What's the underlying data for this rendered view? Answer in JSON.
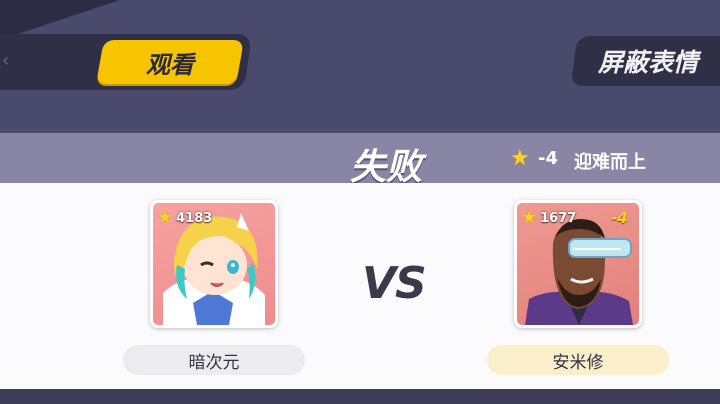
{
  "header": {
    "watch_label": "观看",
    "mute_emotes_label": "屏蔽表情"
  },
  "result": {
    "title": "失败",
    "star_change": "-4",
    "bonus_label": "迎难而上"
  },
  "vs_label": "VS",
  "players": [
    {
      "name": "暗次元",
      "score": "4183",
      "delta": ""
    },
    {
      "name": "安米修",
      "score": "1677",
      "delta": "-4"
    }
  ],
  "colors": {
    "background": "#4a4a6c",
    "accent_yellow": "#f7c400",
    "result_band": "#8886a4",
    "left_name_pill": "#ececf0",
    "right_name_pill": "#fbeeca"
  },
  "icons": [
    "star-icon",
    "chevron-left-icon"
  ]
}
